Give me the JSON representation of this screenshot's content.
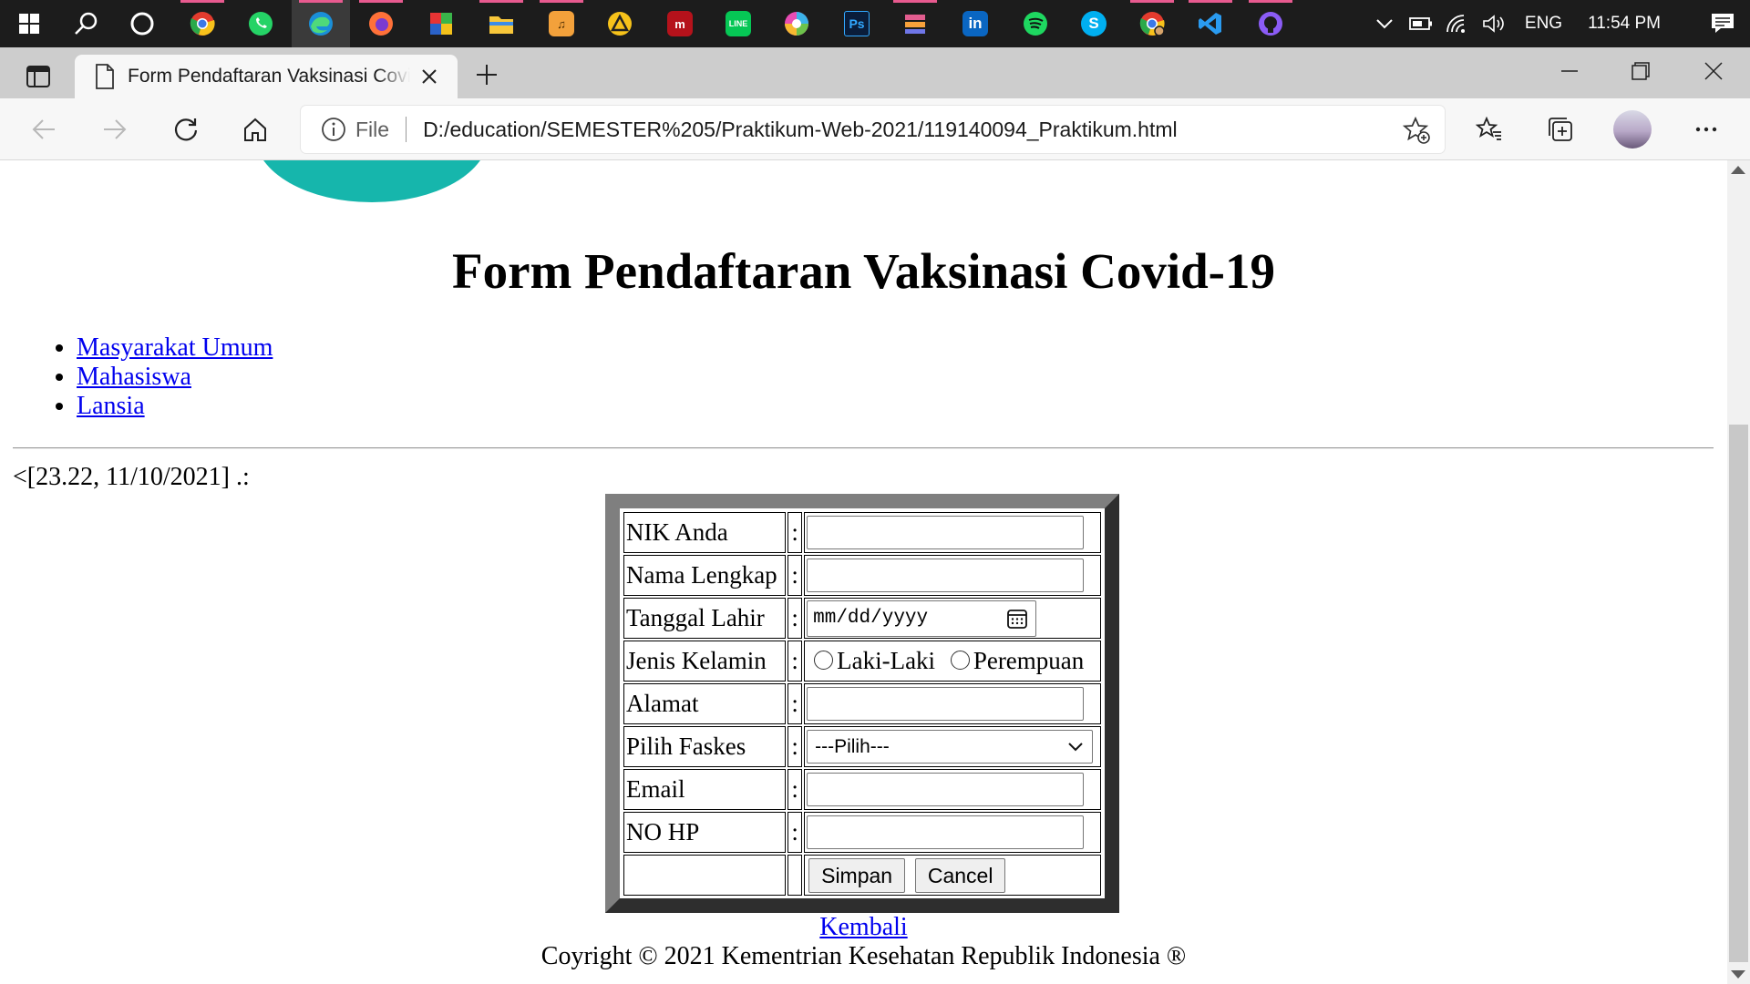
{
  "taskbar": {
    "apps": [
      "windows-start",
      "search",
      "cortana",
      "chrome",
      "whatsapp",
      "edge",
      "firefox",
      "winrar",
      "file-explorer",
      "fl-studio",
      "archicad",
      "mendeley",
      "line",
      "picasa",
      "photoshop",
      "sublime-merge",
      "linkedin",
      "spotify",
      "skype",
      "chrome-profile",
      "vscode",
      "github-desktop"
    ],
    "language": "ENG",
    "time": "11:54 PM"
  },
  "browser": {
    "tab_title": "Form Pendaftaran Vaksinasi Covid-19",
    "url_scheme": "File",
    "url": "D:/education/SEMESTER%205/Praktikum-Web-2021/119140094_Praktikum.html"
  },
  "page": {
    "title": "Form Pendaftaran Vaksinasi Covid-19",
    "nav_links": [
      "Masyarakat Umum",
      "Mahasiswa",
      "Lansia"
    ],
    "timestamp": "<[23.22, 11/10/2021] .:",
    "form": {
      "colon": ":",
      "labels": {
        "nik": "NIK Anda",
        "nama": "Nama Lengkap",
        "tanggal": "Tanggal Lahir",
        "kelamin": "Jenis Kelamin",
        "alamat": "Alamat",
        "faskes": "Pilih Faskes",
        "email": "Email",
        "hp": "NO HP"
      },
      "date_placeholder": "mm/dd/yyyy",
      "gender_options": [
        "Laki-Laki",
        "Perempuan"
      ],
      "faskes_selected": "---Pilih---",
      "submit_label": "Simpan",
      "cancel_label": "Cancel"
    },
    "back_link": "Kembali",
    "footer": "Coyright © 2021 Kementrian Kesehatan Republik Indonesia ®"
  },
  "colors": {
    "taskbar_bg": "#1c1c1c",
    "link": "#0000ee",
    "logo_teal": "#16b6ac"
  }
}
